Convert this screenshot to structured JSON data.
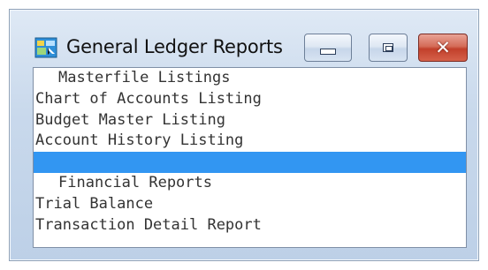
{
  "window": {
    "title": "General Ledger Reports",
    "icon": "ledger-app-icon",
    "buttons": {
      "minimize": "minimize-icon",
      "maximize": "maximize-icon",
      "close": "close-icon"
    }
  },
  "list": {
    "selected_color": "#3296f2",
    "items": [
      {
        "label": "Masterfile Listings",
        "kind": "header"
      },
      {
        "label": "Chart of Accounts Listing",
        "kind": "item"
      },
      {
        "label": "Budget Master Listing",
        "kind": "item"
      },
      {
        "label": "Account History Listing",
        "kind": "item"
      },
      {
        "label": "",
        "kind": "selected-blank"
      },
      {
        "label": "Financial Reports",
        "kind": "header"
      },
      {
        "label": "Trial Balance",
        "kind": "item"
      },
      {
        "label": "Transaction Detail Report",
        "kind": "item"
      }
    ]
  }
}
